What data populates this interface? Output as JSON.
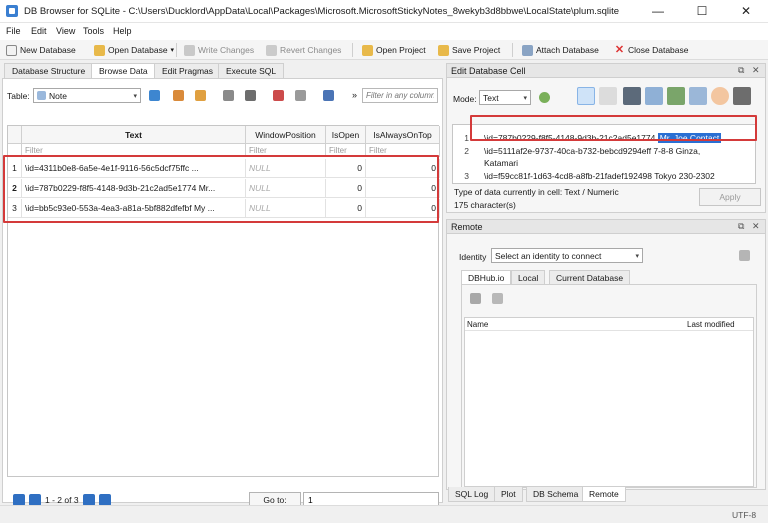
{
  "window": {
    "title": "DB Browser for SQLite - C:\\Users\\Ducklord\\AppData\\Local\\Packages\\Microsoft.MicrosoftStickyNotes_8wekyb3d8bbwe\\LocalState\\plum.sqlite",
    "minimize": "—",
    "maximize": "☐",
    "close": "✕"
  },
  "menu": [
    "File",
    "Edit",
    "View",
    "Tools",
    "Help"
  ],
  "toolbar": {
    "new_database": "New Database",
    "open_database": "Open Database",
    "write_changes": "Write Changes",
    "revert_changes": "Revert Changes",
    "open_project": "Open Project",
    "save_project": "Save Project",
    "attach_database": "Attach Database",
    "close_database": "Close Database"
  },
  "main_tabs": [
    "Database Structure",
    "Browse Data",
    "Edit Pragmas",
    "Execute SQL"
  ],
  "browse": {
    "table_label": "Table:",
    "table_value": "Note",
    "filter_placeholder": "Filter in any column",
    "more": "»",
    "columns": [
      "Text",
      "WindowPosition",
      "IsOpen",
      "IsAlwaysOnTop"
    ],
    "filter_text": "Filter",
    "rows": [
      {
        "num": "1",
        "text": "\\id=4311b0e8-6a5e-4e1f-9116-56c5dcf75ffc ...",
        "window_position": "NULL",
        "is_open": "0",
        "is_always_on_top": "0"
      },
      {
        "num": "2",
        "text": "\\id=787b0229-f8f5-4148-9d3b-21c2ad5e1774 Mr...",
        "window_position": "NULL",
        "is_open": "0",
        "is_always_on_top": "0"
      },
      {
        "num": "3",
        "text": "\\id=bb5c93e0-553a-4ea3-a81a-5bf882dfefbf My ...",
        "window_position": "NULL",
        "is_open": "0",
        "is_always_on_top": "0"
      }
    ],
    "pager_text": "1 - 2 of 3",
    "goto_label": "Go to:",
    "goto_value": "1"
  },
  "edit_cell": {
    "title": "Edit Database Cell",
    "mode_label": "Mode:",
    "mode_value": "Text",
    "lines": [
      {
        "num": "1",
        "text": "\\id=787b0229-f8f5-4148-9d3b-21c2ad5e1774 ",
        "selected": "Mr. Joe Contact"
      },
      {
        "num": "2",
        "text": "\\id=5111af2e-9737-40ca-b732-bebcd9294eff 7-8-8 Ginza,",
        "text2": "Katamari"
      },
      {
        "num": "3",
        "text": "\\id=f59cc81f-1d63-4cd8-a8fb-21fadef192498 Tokyo 230-2302"
      }
    ],
    "type_info": "Type of data currently in cell: Text / Numeric",
    "char_info": "175 character(s)",
    "apply": "Apply"
  },
  "remote": {
    "title": "Remote",
    "identity_label": "Identity",
    "identity_value": "Select an identity to connect",
    "tabs": [
      "DBHub.io",
      "Local",
      "Current Database"
    ],
    "columns": [
      "Name",
      "Last modified"
    ]
  },
  "bottom_tabs": [
    "SQL Log",
    "Plot",
    "DB Schema",
    "Remote"
  ],
  "status": {
    "encoding": "UTF-8"
  },
  "colors": {
    "accent": "#2a6fd3",
    "highlight_box": "#d43a3a"
  }
}
